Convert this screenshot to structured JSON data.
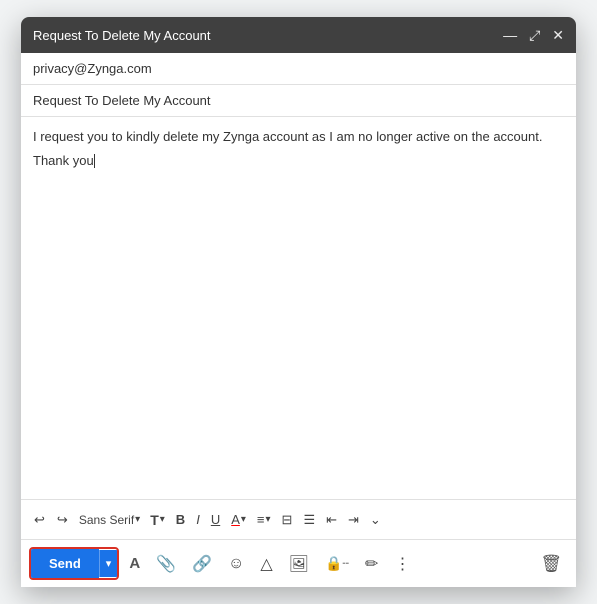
{
  "window": {
    "title": "Request To Delete My Account",
    "controls": {
      "minimize": "—",
      "expand": "⤢",
      "close": "✕"
    }
  },
  "fields": {
    "to": "privacy@Zynga.com",
    "subject": "Request To Delete My Account",
    "body_line1": "I request you to kindly delete my Zynga account as I am no longer active on the account.",
    "body_line2": "Thank you"
  },
  "toolbar": {
    "undo": "↩",
    "redo": "↪",
    "font": "Sans Serif",
    "text_style": "T",
    "bold": "B",
    "italic": "I",
    "underline": "U",
    "text_color": "A",
    "align": "≡",
    "numbered_list": "⊟",
    "bullet_list": "☰",
    "indent_less": "⇤",
    "indent_more": "⇥",
    "more": "⌄"
  },
  "bottom_toolbar": {
    "send_label": "Send",
    "send_dropdown": "▾",
    "icons": {
      "format_text": "A",
      "attach": "📎",
      "link": "🔗",
      "emoji": "☺",
      "drive": "△",
      "image": "🖼",
      "lock": "🔒",
      "pen": "✏",
      "more": "⋮",
      "delete": "🗑"
    }
  }
}
